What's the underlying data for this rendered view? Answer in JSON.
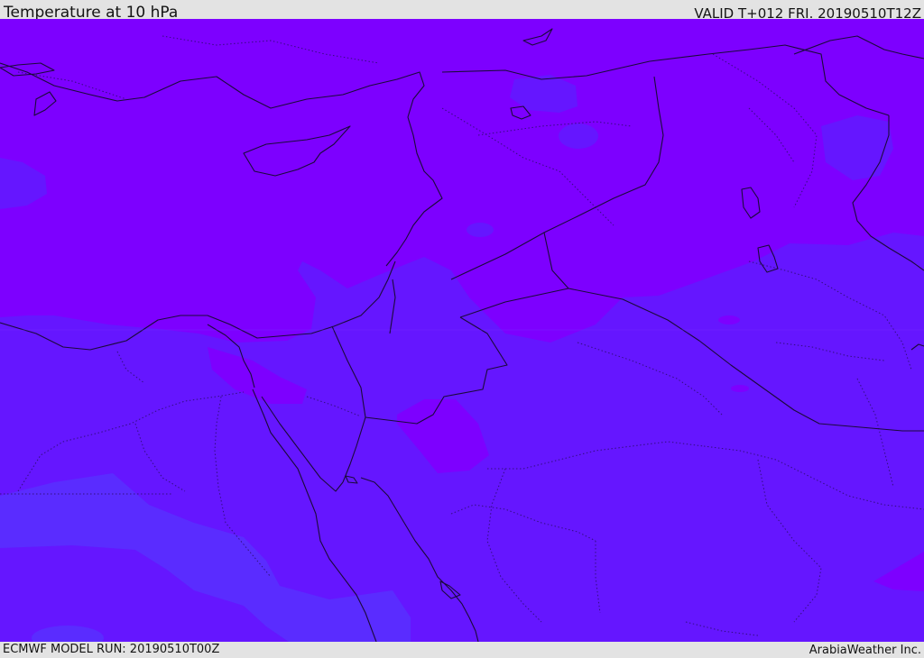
{
  "header": {
    "title": "Temperature at 10 hPa",
    "valid_time": "VALID T+012 FRI. 20190510T12Z"
  },
  "footer": {
    "model_run": "ECMWF MODEL RUN: 20190510T00Z",
    "credit": "ArabiaWeather Inc."
  },
  "map": {
    "variable": "temperature",
    "level": "10 hPa",
    "region": "Middle East",
    "colors": {
      "warm_band": "#7d00ff",
      "mid_band": "#6516ff",
      "cool_band": "#5a2cff",
      "boundary_lines": "#1b0a3a"
    }
  }
}
